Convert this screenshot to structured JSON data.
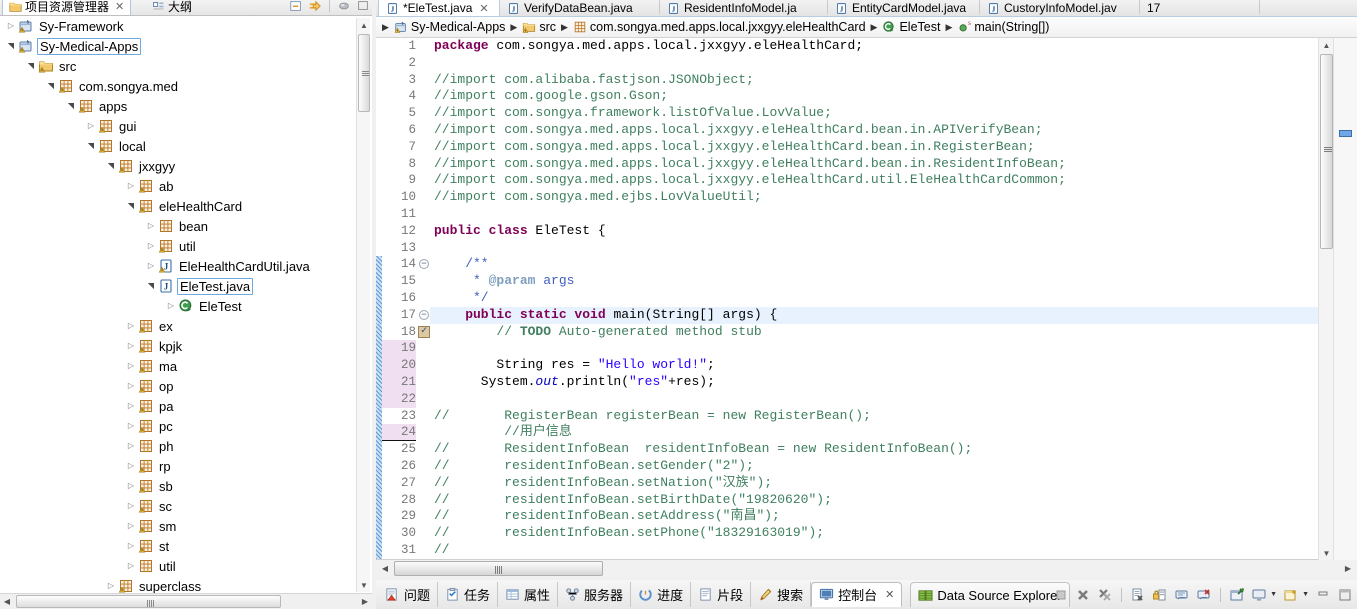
{
  "left_panel": {
    "tabs": [
      {
        "label": "项目资源管理器",
        "icon": "project-explorer-icon",
        "active": true,
        "closable": true
      },
      {
        "label": "大纲",
        "icon": "outline-icon",
        "active": false,
        "closable": false
      }
    ],
    "toolbar": [
      {
        "name": "collapse-all-icon"
      },
      {
        "name": "link-with-editor-icon"
      },
      {
        "name": "view-menu-icon"
      },
      {
        "name": "minimize-icon"
      }
    ],
    "tree": [
      {
        "label": "Sy-Framework",
        "indent": 0,
        "twist": "collapsed",
        "icon": "java-project-icon",
        "selected": false
      },
      {
        "label": "Sy-Medical-Apps",
        "indent": 0,
        "twist": "expanded",
        "icon": "java-project-icon",
        "selected": true
      },
      {
        "label": "src",
        "indent": 1,
        "twist": "expanded",
        "icon": "source-folder-icon",
        "selected": false
      },
      {
        "label": "com.songya.med",
        "indent": 2,
        "twist": "expanded",
        "icon": "package-warn-icon",
        "selected": false
      },
      {
        "label": "apps",
        "indent": 3,
        "twist": "expanded",
        "icon": "package-warn-icon",
        "selected": false
      },
      {
        "label": "gui",
        "indent": 4,
        "twist": "collapsed",
        "icon": "package-warn-icon",
        "selected": false
      },
      {
        "label": "local",
        "indent": 4,
        "twist": "expanded",
        "icon": "package-warn-icon",
        "selected": false
      },
      {
        "label": "jxxgyy",
        "indent": 5,
        "twist": "expanded",
        "icon": "package-warn-icon",
        "selected": false
      },
      {
        "label": "ab",
        "indent": 6,
        "twist": "collapsed",
        "icon": "package-warn-icon",
        "selected": false
      },
      {
        "label": "eleHealthCard",
        "indent": 6,
        "twist": "expanded",
        "icon": "package-warn-icon",
        "selected": false
      },
      {
        "label": "bean",
        "indent": 7,
        "twist": "collapsed",
        "icon": "package-icon",
        "selected": false
      },
      {
        "label": "util",
        "indent": 7,
        "twist": "collapsed",
        "icon": "package-warn-icon",
        "selected": false
      },
      {
        "label": "EleHealthCardUtil.java",
        "indent": 7,
        "twist": "collapsed",
        "icon": "java-file-warn-icon",
        "selected": false
      },
      {
        "label": "EleTest.java",
        "indent": 7,
        "twist": "expanded",
        "icon": "java-file-icon",
        "selected": true
      },
      {
        "label": "EleTest",
        "indent": 8,
        "twist": "collapsed",
        "icon": "java-class-icon",
        "selected": false
      },
      {
        "label": "ex",
        "indent": 6,
        "twist": "collapsed",
        "icon": "package-warn-icon",
        "selected": false
      },
      {
        "label": "kpjk",
        "indent": 6,
        "twist": "collapsed",
        "icon": "package-warn-icon",
        "selected": false
      },
      {
        "label": "ma",
        "indent": 6,
        "twist": "collapsed",
        "icon": "package-warn-icon",
        "selected": false
      },
      {
        "label": "op",
        "indent": 6,
        "twist": "collapsed",
        "icon": "package-warn-icon",
        "selected": false
      },
      {
        "label": "pa",
        "indent": 6,
        "twist": "collapsed",
        "icon": "package-warn-icon",
        "selected": false
      },
      {
        "label": "pc",
        "indent": 6,
        "twist": "collapsed",
        "icon": "package-warn-icon",
        "selected": false
      },
      {
        "label": "ph",
        "indent": 6,
        "twist": "collapsed",
        "icon": "package-icon",
        "selected": false
      },
      {
        "label": "rp",
        "indent": 6,
        "twist": "collapsed",
        "icon": "package-warn-icon",
        "selected": false
      },
      {
        "label": "sb",
        "indent": 6,
        "twist": "collapsed",
        "icon": "package-warn-icon",
        "selected": false
      },
      {
        "label": "sc",
        "indent": 6,
        "twist": "collapsed",
        "icon": "package-warn-icon",
        "selected": false
      },
      {
        "label": "sm",
        "indent": 6,
        "twist": "collapsed",
        "icon": "package-warn-icon",
        "selected": false
      },
      {
        "label": "st",
        "indent": 6,
        "twist": "collapsed",
        "icon": "package-warn-icon",
        "selected": false
      },
      {
        "label": "util",
        "indent": 6,
        "twist": "collapsed",
        "icon": "package-icon",
        "selected": false
      },
      {
        "label": "superclass",
        "indent": 5,
        "twist": "collapsed",
        "icon": "package-warn-icon",
        "selected": false
      }
    ]
  },
  "editor": {
    "tabs": [
      {
        "label": "*EleTest.java",
        "active": true,
        "closable": true
      },
      {
        "label": "VerifyDataBean.java",
        "active": false,
        "closable": false
      },
      {
        "label": "ResidentInfoModel.ja",
        "active": false,
        "closable": false
      },
      {
        "label": "EntityCardModel.java",
        "active": false,
        "closable": false
      },
      {
        "label": "CustoryInfoModel.jav",
        "active": false,
        "closable": false
      },
      {
        "label": "17",
        "active": false,
        "closable": false
      }
    ],
    "breadcrumb": [
      {
        "label": "Sy-Medical-Apps",
        "icon": "java-project-icon"
      },
      {
        "label": "src",
        "icon": "source-folder-icon"
      },
      {
        "label": "com.songya.med.apps.local.jxxgyy.eleHealthCard",
        "icon": "package-icon"
      },
      {
        "label": "EleTest",
        "icon": "java-class-icon"
      },
      {
        "label": "main(String[])",
        "icon": "method-public-static-icon"
      }
    ],
    "code": [
      {
        "num": "1",
        "changed": false,
        "diff": false,
        "current": false,
        "fold": null,
        "marker": null,
        "tokens": [
          {
            "t": "package",
            "c": "kw"
          },
          {
            "t": " com.songya.med.apps.local.jxxgyy.eleHealthCard;",
            "c": "pln"
          }
        ]
      },
      {
        "num": "2",
        "changed": false,
        "diff": false,
        "current": false,
        "fold": null,
        "marker": null,
        "tokens": []
      },
      {
        "num": "3",
        "changed": false,
        "diff": false,
        "current": false,
        "fold": null,
        "marker": null,
        "tokens": [
          {
            "t": "//import com.alibaba.fastjson.JSONObject;",
            "c": "cmt"
          }
        ]
      },
      {
        "num": "4",
        "changed": false,
        "diff": false,
        "current": false,
        "fold": null,
        "marker": null,
        "tokens": [
          {
            "t": "//import com.google.gson.Gson;",
            "c": "cmt"
          }
        ]
      },
      {
        "num": "5",
        "changed": false,
        "diff": false,
        "current": false,
        "fold": null,
        "marker": null,
        "tokens": [
          {
            "t": "//import com.songya.framework.listOfValue.LovValue;",
            "c": "cmt"
          }
        ]
      },
      {
        "num": "6",
        "changed": false,
        "diff": false,
        "current": false,
        "fold": null,
        "marker": null,
        "tokens": [
          {
            "t": "//import com.songya.med.apps.local.jxxgyy.eleHealthCard.bean.in.APIVerifyBean;",
            "c": "cmt"
          }
        ]
      },
      {
        "num": "7",
        "changed": false,
        "diff": false,
        "current": false,
        "fold": null,
        "marker": null,
        "tokens": [
          {
            "t": "//import com.songya.med.apps.local.jxxgyy.eleHealthCard.bean.in.RegisterBean;",
            "c": "cmt"
          }
        ]
      },
      {
        "num": "8",
        "changed": false,
        "diff": false,
        "current": false,
        "fold": null,
        "marker": null,
        "tokens": [
          {
            "t": "//import com.songya.med.apps.local.jxxgyy.eleHealthCard.bean.in.ResidentInfoBean;",
            "c": "cmt"
          }
        ]
      },
      {
        "num": "9",
        "changed": false,
        "diff": false,
        "current": false,
        "fold": null,
        "marker": null,
        "tokens": [
          {
            "t": "//import com.songya.med.apps.local.jxxgyy.eleHealthCard.util.EleHealthCardCommon;",
            "c": "cmt"
          }
        ]
      },
      {
        "num": "10",
        "changed": false,
        "diff": false,
        "current": false,
        "fold": null,
        "marker": null,
        "tokens": [
          {
            "t": "//import com.songya.med.ejbs.LovValueUtil;",
            "c": "cmt"
          }
        ]
      },
      {
        "num": "11",
        "changed": false,
        "diff": false,
        "current": false,
        "fold": null,
        "marker": null,
        "tokens": []
      },
      {
        "num": "12",
        "changed": false,
        "diff": false,
        "current": false,
        "fold": null,
        "marker": null,
        "tokens": [
          {
            "t": "public class",
            "c": "kw"
          },
          {
            "t": " EleTest {",
            "c": "pln"
          }
        ]
      },
      {
        "num": "13",
        "changed": false,
        "diff": false,
        "current": false,
        "fold": null,
        "marker": null,
        "tokens": []
      },
      {
        "num": "14",
        "changed": false,
        "diff": true,
        "current": false,
        "fold": "⊖",
        "marker": null,
        "tokens": [
          {
            "t": "    /**",
            "c": "jdoc"
          }
        ]
      },
      {
        "num": "15",
        "changed": false,
        "diff": true,
        "current": false,
        "fold": null,
        "marker": null,
        "tokens": [
          {
            "t": "     * ",
            "c": "jdoc"
          },
          {
            "t": "@param",
            "c": "jtag"
          },
          {
            "t": " args",
            "c": "jdoc"
          }
        ]
      },
      {
        "num": "16",
        "changed": false,
        "diff": true,
        "current": false,
        "fold": null,
        "marker": null,
        "tokens": [
          {
            "t": "     */",
            "c": "jdoc"
          }
        ]
      },
      {
        "num": "17",
        "changed": false,
        "diff": true,
        "current": true,
        "fold": "⊖",
        "marker": null,
        "tokens": [
          {
            "t": "    public static void",
            "c": "kw"
          },
          {
            "t": " main(String[] args) {",
            "c": "pln"
          }
        ]
      },
      {
        "num": "18",
        "changed": false,
        "diff": true,
        "current": false,
        "fold": null,
        "marker": "checked",
        "tokens": [
          {
            "t": "        // ",
            "c": "cmt"
          },
          {
            "t": "TODO",
            "c": "todo"
          },
          {
            "t": " Auto-generated method stub",
            "c": "cmt"
          }
        ]
      },
      {
        "num": "19",
        "changed": true,
        "diff": true,
        "current": false,
        "fold": null,
        "marker": null,
        "tokens": []
      },
      {
        "num": "20",
        "changed": true,
        "diff": true,
        "current": false,
        "fold": null,
        "marker": null,
        "tokens": [
          {
            "t": "        String res = ",
            "c": "pln"
          },
          {
            "t": "\"Hello world!\"",
            "c": "str"
          },
          {
            "t": ";",
            "c": "pln"
          }
        ]
      },
      {
        "num": "21",
        "changed": true,
        "diff": true,
        "current": false,
        "fold": null,
        "marker": null,
        "tokens": [
          {
            "t": "      System.",
            "c": "pln"
          },
          {
            "t": "out",
            "c": "fld"
          },
          {
            "t": ".println(",
            "c": "pln"
          },
          {
            "t": "\"res\"",
            "c": "str"
          },
          {
            "t": "+res);",
            "c": "pln"
          }
        ]
      },
      {
        "num": "22",
        "changed": true,
        "diff": true,
        "current": false,
        "fold": null,
        "marker": null,
        "tokens": []
      },
      {
        "num": "23",
        "changed": false,
        "diff": true,
        "current": false,
        "fold": null,
        "marker": null,
        "tokens": [
          {
            "t": "//       RegisterBean registerBean = new RegisterBean();",
            "c": "cmt"
          }
        ]
      },
      {
        "num": "24",
        "changed": true,
        "diff": true,
        "current": false,
        "fold": null,
        "marker": null,
        "tokens": [
          {
            "t": "         //用户信息",
            "c": "cmt"
          }
        ]
      },
      {
        "num": "25",
        "changed": false,
        "diff": true,
        "current": false,
        "fold": null,
        "marker": null,
        "tokens": [
          {
            "t": "//       ResidentInfoBean  residentInfoBean = new ResidentInfoBean();",
            "c": "cmt"
          }
        ]
      },
      {
        "num": "26",
        "changed": false,
        "diff": true,
        "current": false,
        "fold": null,
        "marker": null,
        "tokens": [
          {
            "t": "//       residentInfoBean.setGender(\"2\");",
            "c": "cmt"
          }
        ]
      },
      {
        "num": "27",
        "changed": false,
        "diff": true,
        "current": false,
        "fold": null,
        "marker": null,
        "tokens": [
          {
            "t": "//       residentInfoBean.setNation(\"汉族\");",
            "c": "cmt"
          }
        ]
      },
      {
        "num": "28",
        "changed": false,
        "diff": true,
        "current": false,
        "fold": null,
        "marker": null,
        "tokens": [
          {
            "t": "//       residentInfoBean.setBirthDate(\"19820620\");",
            "c": "cmt"
          }
        ]
      },
      {
        "num": "29",
        "changed": false,
        "diff": true,
        "current": false,
        "fold": null,
        "marker": null,
        "tokens": [
          {
            "t": "//       residentInfoBean.setAddress(\"南昌\");",
            "c": "cmt"
          }
        ]
      },
      {
        "num": "30",
        "changed": false,
        "diff": true,
        "current": false,
        "fold": null,
        "marker": null,
        "tokens": [
          {
            "t": "//       residentInfoBean.setPhone(\"18329163019\");",
            "c": "cmt"
          }
        ]
      },
      {
        "num": "31",
        "changed": false,
        "diff": true,
        "current": false,
        "fold": null,
        "marker": null,
        "tokens": [
          {
            "t": "//",
            "c": "cmt"
          }
        ]
      }
    ]
  },
  "bottom": {
    "tabs": [
      {
        "label": "问题",
        "icon": "problems-icon",
        "active": false,
        "closable": false
      },
      {
        "label": "任务",
        "icon": "tasks-icon",
        "active": false,
        "closable": false
      },
      {
        "label": "属性",
        "icon": "properties-icon",
        "active": false,
        "closable": false
      },
      {
        "label": "服务器",
        "icon": "servers-icon",
        "active": false,
        "closable": false
      },
      {
        "label": "进度",
        "icon": "progress-icon",
        "active": false,
        "closable": false
      },
      {
        "label": "片段",
        "icon": "snippets-icon",
        "active": false,
        "closable": false
      },
      {
        "label": "搜索",
        "icon": "search-icon",
        "active": false,
        "closable": false
      },
      {
        "label": "控制台",
        "icon": "console-icon",
        "active": true,
        "closable": true
      },
      {
        "label": "Data Source Explorer",
        "icon": "datasource-icon",
        "active": false,
        "closable": false
      }
    ],
    "toolbar": [
      {
        "name": "terminate-icon"
      },
      {
        "name": "remove-launch-icon"
      },
      {
        "name": "remove-all-terminated-icon"
      },
      {
        "name": "clear-console-icon"
      },
      {
        "name": "scroll-lock-icon"
      },
      {
        "name": "show-console-on-output-icon"
      },
      {
        "name": "show-console-on-error-icon"
      },
      {
        "name": "pin-console-icon"
      },
      {
        "name": "display-selected-console-icon"
      },
      {
        "name": "open-console-icon"
      },
      {
        "name": "minimize-icon"
      },
      {
        "name": "maximize-icon"
      }
    ]
  },
  "colors": {
    "keyword": "#7f0055",
    "comment": "#3f7f5f",
    "javadoc": "#3f5fbf",
    "string": "#2a00ff",
    "field": "#0000c0",
    "current_line": "#e8f2fe",
    "changed_line": "#f0dff0",
    "diff_bar": "#5c9ad6",
    "selection_border": "#6fa8dc"
  }
}
